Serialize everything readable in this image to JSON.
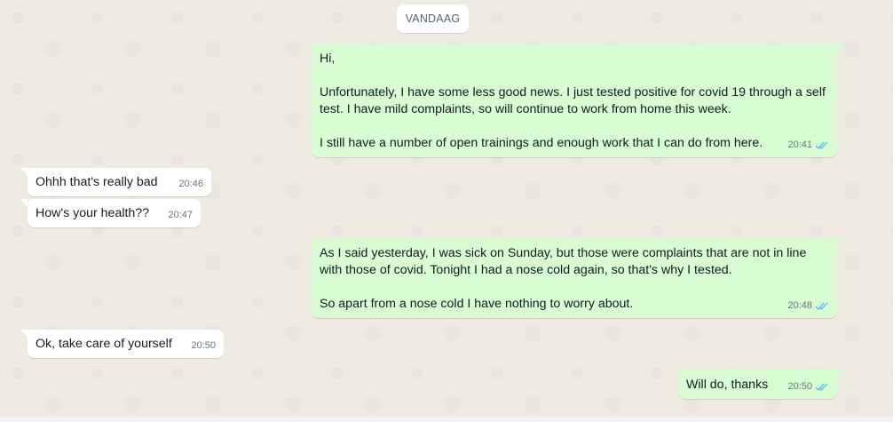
{
  "date_separator": "VANDAAG",
  "colors": {
    "background": "#efeae2",
    "outgoing_bubble": "#d9fdd3",
    "incoming_bubble": "#ffffff",
    "read_tick": "#53bdeb",
    "timestamp": "#667781"
  },
  "messages": [
    {
      "direction": "outgoing",
      "text": "Hi,\n\nUnfortunately, I have some less good news. I just tested positive for covid 19 through a self test. I have mild complaints, so will continue to work from home this week.\n\nI still have a number of open trainings and enough work that I can do from here.",
      "time": "20:41",
      "status_icon": "double-check-read-icon"
    },
    {
      "direction": "incoming",
      "text": "Ohhh that's really bad",
      "time": "20:46"
    },
    {
      "direction": "incoming",
      "text": "How's your health??",
      "time": "20:47"
    },
    {
      "direction": "outgoing",
      "text": "As I said yesterday, I was sick on Sunday, but those were complaints that are not in line with those of covid. Tonight I had a nose cold again, so that's why I tested.\n\nSo apart from a nose cold I have nothing to worry about.",
      "time": "20:48",
      "status_icon": "double-check-read-icon"
    },
    {
      "direction": "incoming",
      "text": "Ok, take care of yourself",
      "time": "20:50"
    },
    {
      "direction": "outgoing",
      "text": "Will do, thanks",
      "time": "20:50",
      "status_icon": "double-check-read-icon"
    }
  ]
}
